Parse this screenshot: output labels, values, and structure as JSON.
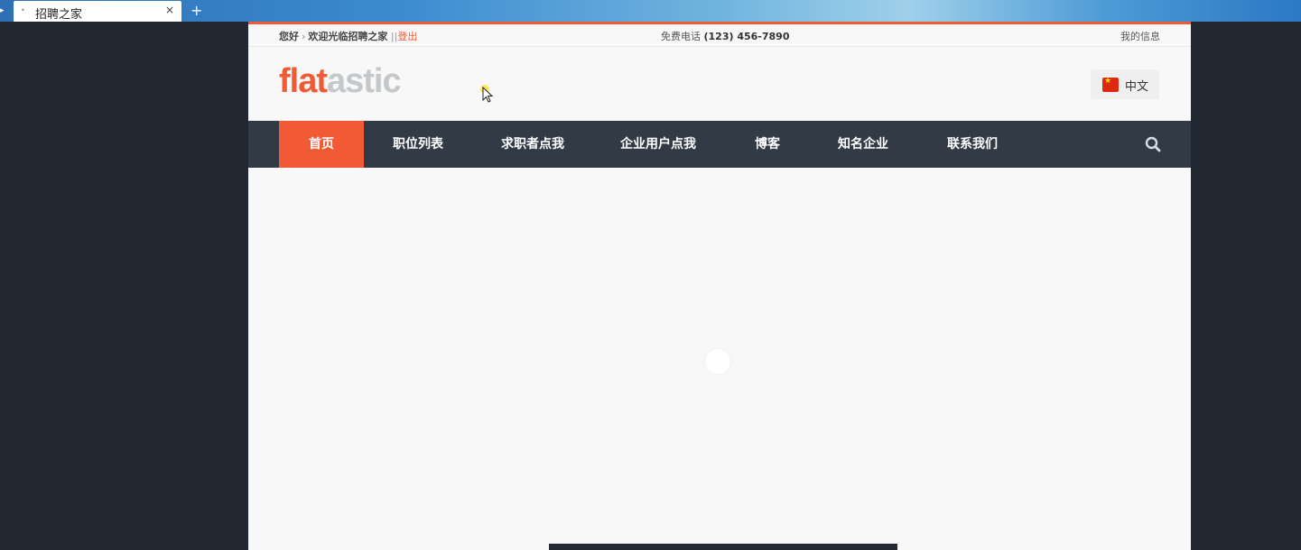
{
  "browser": {
    "tab_title": "招聘之家",
    "close_glyph": "×",
    "new_tab_glyph": "+"
  },
  "topbar": {
    "greeting": "您好",
    "separator": "›",
    "welcome": "欢迎光临招聘之家",
    "divider": "||",
    "logout": "登出",
    "phone_label": "免费电话",
    "phone_number": "(123) 456-7890",
    "my_info": "我的信息"
  },
  "logo": {
    "part1": "flat",
    "part2": "astic"
  },
  "language": {
    "label": "中文",
    "icon": "china-flag-icon"
  },
  "nav": {
    "items": [
      "首页",
      "职位列表",
      "求职者点我",
      "企业用户点我",
      "博客",
      "知名企业",
      "联系我们"
    ],
    "active_index": 0,
    "search_icon": "search-icon"
  },
  "colors": {
    "accent": "#f15a35",
    "nav_bg": "#323a45",
    "page_bg": "#f7f8f7",
    "outer_bg": "#222831"
  }
}
